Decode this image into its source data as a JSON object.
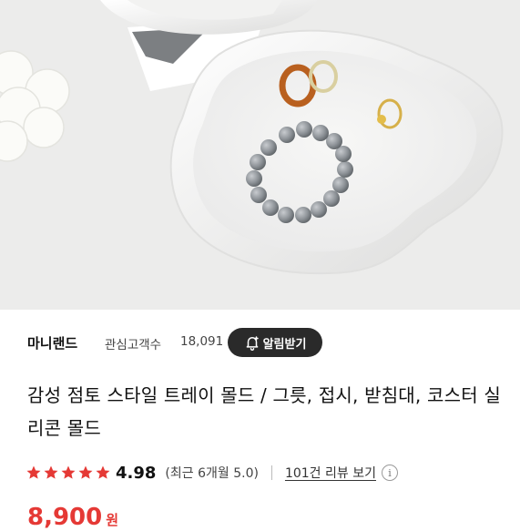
{
  "product_image": {
    "alt": "",
    "icon": "product-photo"
  },
  "store": {
    "name": "마니랜드",
    "follower_label": "관심고객수",
    "follower_count": "18,091",
    "notify_label": "알림받기"
  },
  "product": {
    "title": "감성 점토 스타일 트레이 몰드 / 그릇, 접시, 받침대, 코스터 실리콘 몰드"
  },
  "rating": {
    "stars": 5,
    "value": "4.98",
    "recent": "(최근 6개월 5.0)",
    "review_link": "101건 리뷰 보기",
    "info_icon": "i"
  },
  "price": {
    "amount": "8,900",
    "unit": "원"
  },
  "colors": {
    "star": "#e53935",
    "price": "#e53935",
    "button_bg": "#2a2a2a"
  }
}
